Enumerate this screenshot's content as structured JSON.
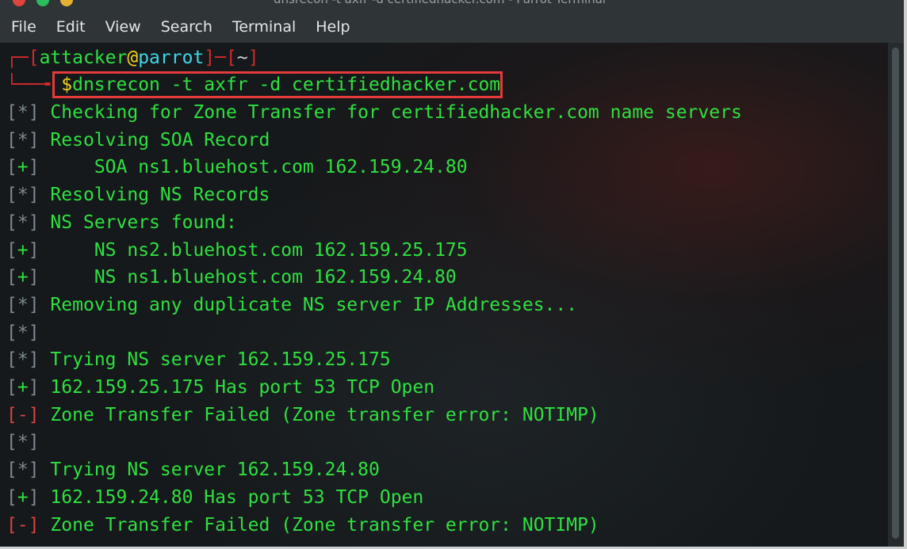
{
  "window": {
    "title": "dnsrecon -t axfr -d certifiedhacker.com - Parrot Terminal"
  },
  "menu": [
    "File",
    "Edit",
    "View",
    "Search",
    "Terminal",
    "Help"
  ],
  "prompt": {
    "corner_top": "┌─",
    "open": "[",
    "user": "attacker",
    "at": "@",
    "host": "parrot",
    "sep": "]─[",
    "dir": "~",
    "close": "]",
    "corner_bottom": "└──╼ ",
    "dollar": "$",
    "command": "dnsrecon -t axfr -d certifiedhacker.com"
  },
  "output": [
    {
      "mark": "[*]",
      "type": "info",
      "text": " Checking for Zone Transfer for certifiedhacker.com name servers"
    },
    {
      "mark": "[*]",
      "type": "info",
      "text": " Resolving SOA Record"
    },
    {
      "mark": "[+]",
      "type": "ok",
      "text": "     SOA ns1.bluehost.com 162.159.24.80"
    },
    {
      "mark": "[*]",
      "type": "info",
      "text": " Resolving NS Records"
    },
    {
      "mark": "[*]",
      "type": "info",
      "text": " NS Servers found:"
    },
    {
      "mark": "[+]",
      "type": "ok",
      "text": "     NS ns2.bluehost.com 162.159.25.175"
    },
    {
      "mark": "[+]",
      "type": "ok",
      "text": "     NS ns1.bluehost.com 162.159.24.80"
    },
    {
      "mark": "[*]",
      "type": "info",
      "text": " Removing any duplicate NS server IP Addresses..."
    },
    {
      "mark": "[*]",
      "type": "info",
      "text": ""
    },
    {
      "mark": "[*]",
      "type": "info",
      "text": " Trying NS server 162.159.25.175"
    },
    {
      "mark": "[+]",
      "type": "ok",
      "text": " 162.159.25.175 Has port 53 TCP Open"
    },
    {
      "mark": "[-]",
      "type": "err",
      "text": " Zone Transfer Failed (Zone transfer error: NOTIMP)"
    },
    {
      "mark": "[*]",
      "type": "info",
      "text": ""
    },
    {
      "mark": "[*]",
      "type": "info",
      "text": " Trying NS server 162.159.24.80"
    },
    {
      "mark": "[+]",
      "type": "ok",
      "text": " 162.159.24.80 Has port 53 TCP Open"
    },
    {
      "mark": "[-]",
      "type": "err",
      "text": " Zone Transfer Failed (Zone transfer error: NOTIMP)"
    }
  ]
}
